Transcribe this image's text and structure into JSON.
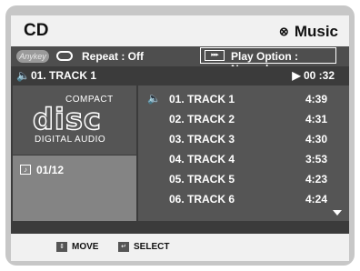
{
  "header": {
    "title": "CD",
    "mode_icon": "⊗",
    "mode_label": "Music"
  },
  "options": {
    "anykey_label": "Anykey",
    "repeat_label": "Repeat : Off",
    "play_option_icon_text": "▸▸▸",
    "play_option_label": "Play Option : Normal"
  },
  "now_playing": {
    "speaker_icon": "🔈",
    "track": "01. TRACK 1",
    "time": "▶ 00 :32"
  },
  "disc_logo": {
    "top": "COMPACT",
    "word": "disc",
    "bottom": "DIGITAL AUDIO"
  },
  "counter": {
    "icon": "♪",
    "value": "01/12"
  },
  "tracks": [
    {
      "name": "01. TRACK 1",
      "duration": "4:39",
      "playing": true
    },
    {
      "name": "02. TRACK 2",
      "duration": "4:31",
      "playing": false
    },
    {
      "name": "03. TRACK 3",
      "duration": "4:30",
      "playing": false
    },
    {
      "name": "04. TRACK 4",
      "duration": "3:53",
      "playing": false
    },
    {
      "name": "05. TRACK 5",
      "duration": "4:23",
      "playing": false
    },
    {
      "name": "06. TRACK 6",
      "duration": "4:24",
      "playing": false
    }
  ],
  "footer": {
    "move_key": "⇕",
    "move_label": "MOVE",
    "select_key": "↵",
    "select_label": "SELECT"
  },
  "colors": {
    "background": "#3b3b3b",
    "panel": "#555555",
    "panel_light": "#848484",
    "header": "#f1f1f1"
  }
}
